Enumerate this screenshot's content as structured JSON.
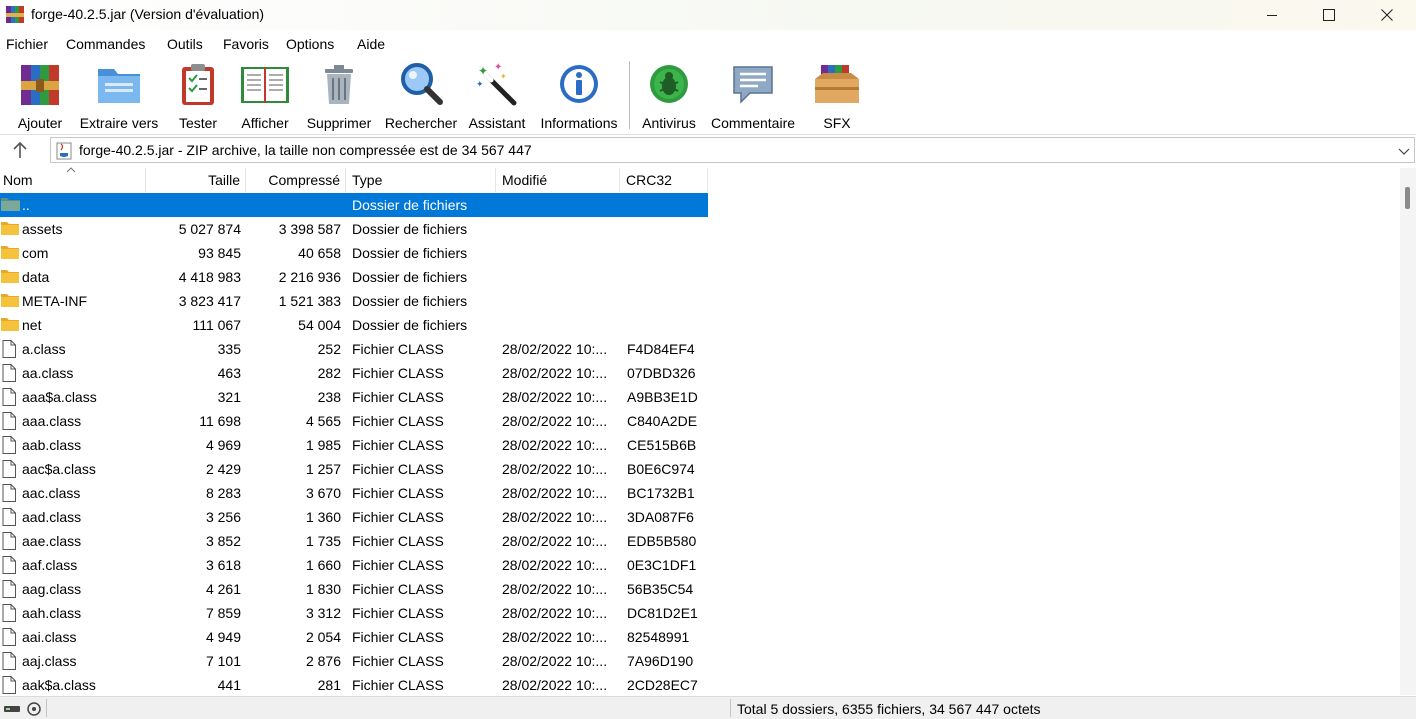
{
  "window": {
    "title": "forge-40.2.5.jar (Version d'évaluation)",
    "controls": {
      "minimize": "—",
      "maximize": "☐",
      "close": "✕"
    }
  },
  "menu": [
    "Fichier",
    "Commandes",
    "Outils",
    "Favoris",
    "Options",
    "Aide"
  ],
  "toolbar": [
    {
      "label": "Ajouter",
      "icon": "add-archive-icon"
    },
    {
      "label": "Extraire vers",
      "icon": "extract-folder-icon"
    },
    {
      "label": "Tester",
      "icon": "test-clipboard-icon"
    },
    {
      "label": "Afficher",
      "icon": "view-book-icon"
    },
    {
      "label": "Supprimer",
      "icon": "trash-can-icon"
    },
    {
      "label": "Rechercher",
      "icon": "magnifier-icon"
    },
    {
      "label": "Assistant",
      "icon": "wizard-wand-icon"
    },
    {
      "label": "Informations",
      "icon": "info-icon"
    },
    {
      "label": "Antivirus",
      "icon": "bug-icon"
    },
    {
      "label": "Commentaire",
      "icon": "comment-icon"
    },
    {
      "label": "SFX",
      "icon": "sfx-box-icon"
    }
  ],
  "address": {
    "text": "forge-40.2.5.jar - ZIP archive, la taille non compressée est de 34 567 447"
  },
  "columns": [
    "Nom",
    "Taille",
    "Compressé",
    "Type",
    "Modifié",
    "CRC32"
  ],
  "rows": [
    {
      "name": "..",
      "size": "",
      "packed": "",
      "type": "Dossier de fichiers",
      "modified": "",
      "crc": "",
      "kind": "parent"
    },
    {
      "name": "assets",
      "size": "5 027 874",
      "packed": "3 398 587",
      "type": "Dossier de fichiers",
      "modified": "",
      "crc": "",
      "kind": "folder"
    },
    {
      "name": "com",
      "size": "93 845",
      "packed": "40 658",
      "type": "Dossier de fichiers",
      "modified": "",
      "crc": "",
      "kind": "folder"
    },
    {
      "name": "data",
      "size": "4 418 983",
      "packed": "2 216 936",
      "type": "Dossier de fichiers",
      "modified": "",
      "crc": "",
      "kind": "folder"
    },
    {
      "name": "META-INF",
      "size": "3 823 417",
      "packed": "1 521 383",
      "type": "Dossier de fichiers",
      "modified": "",
      "crc": "",
      "kind": "folder"
    },
    {
      "name": "net",
      "size": "111 067",
      "packed": "54 004",
      "type": "Dossier de fichiers",
      "modified": "",
      "crc": "",
      "kind": "folder"
    },
    {
      "name": "a.class",
      "size": "335",
      "packed": "252",
      "type": "Fichier CLASS",
      "modified": "28/02/2022 10:...",
      "crc": "F4D84EF4",
      "kind": "file"
    },
    {
      "name": "aa.class",
      "size": "463",
      "packed": "282",
      "type": "Fichier CLASS",
      "modified": "28/02/2022 10:...",
      "crc": "07DBD326",
      "kind": "file"
    },
    {
      "name": "aaa$a.class",
      "size": "321",
      "packed": "238",
      "type": "Fichier CLASS",
      "modified": "28/02/2022 10:...",
      "crc": "A9BB3E1D",
      "kind": "file"
    },
    {
      "name": "aaa.class",
      "size": "11 698",
      "packed": "4 565",
      "type": "Fichier CLASS",
      "modified": "28/02/2022 10:...",
      "crc": "C840A2DE",
      "kind": "file"
    },
    {
      "name": "aab.class",
      "size": "4 969",
      "packed": "1 985",
      "type": "Fichier CLASS",
      "modified": "28/02/2022 10:...",
      "crc": "CE515B6B",
      "kind": "file"
    },
    {
      "name": "aac$a.class",
      "size": "2 429",
      "packed": "1 257",
      "type": "Fichier CLASS",
      "modified": "28/02/2022 10:...",
      "crc": "B0E6C974",
      "kind": "file"
    },
    {
      "name": "aac.class",
      "size": "8 283",
      "packed": "3 670",
      "type": "Fichier CLASS",
      "modified": "28/02/2022 10:...",
      "crc": "BC1732B1",
      "kind": "file"
    },
    {
      "name": "aad.class",
      "size": "3 256",
      "packed": "1 360",
      "type": "Fichier CLASS",
      "modified": "28/02/2022 10:...",
      "crc": "3DA087F6",
      "kind": "file"
    },
    {
      "name": "aae.class",
      "size": "3 852",
      "packed": "1 735",
      "type": "Fichier CLASS",
      "modified": "28/02/2022 10:...",
      "crc": "EDB5B580",
      "kind": "file"
    },
    {
      "name": "aaf.class",
      "size": "3 618",
      "packed": "1 660",
      "type": "Fichier CLASS",
      "modified": "28/02/2022 10:...",
      "crc": "0E3C1DF1",
      "kind": "file"
    },
    {
      "name": "aag.class",
      "size": "4 261",
      "packed": "1 830",
      "type": "Fichier CLASS",
      "modified": "28/02/2022 10:...",
      "crc": "56B35C54",
      "kind": "file"
    },
    {
      "name": "aah.class",
      "size": "7 859",
      "packed": "3 312",
      "type": "Fichier CLASS",
      "modified": "28/02/2022 10:...",
      "crc": "DC81D2E1",
      "kind": "file"
    },
    {
      "name": "aai.class",
      "size": "4 949",
      "packed": "2 054",
      "type": "Fichier CLASS",
      "modified": "28/02/2022 10:...",
      "crc": "82548991",
      "kind": "file"
    },
    {
      "name": "aaj.class",
      "size": "7 101",
      "packed": "2 876",
      "type": "Fichier CLASS",
      "modified": "28/02/2022 10:...",
      "crc": "7A96D190",
      "kind": "file"
    },
    {
      "name": "aak$a.class",
      "size": "441",
      "packed": "281",
      "type": "Fichier CLASS",
      "modified": "28/02/2022 10:...",
      "crc": "2CD28EC7",
      "kind": "file"
    }
  ],
  "selected_row": 0,
  "status": {
    "summary": "Total 5 dossiers, 6355 fichiers, 34 567 447 octets"
  },
  "colors": {
    "selection": "#0078d7",
    "folder": "#f5c33b"
  }
}
